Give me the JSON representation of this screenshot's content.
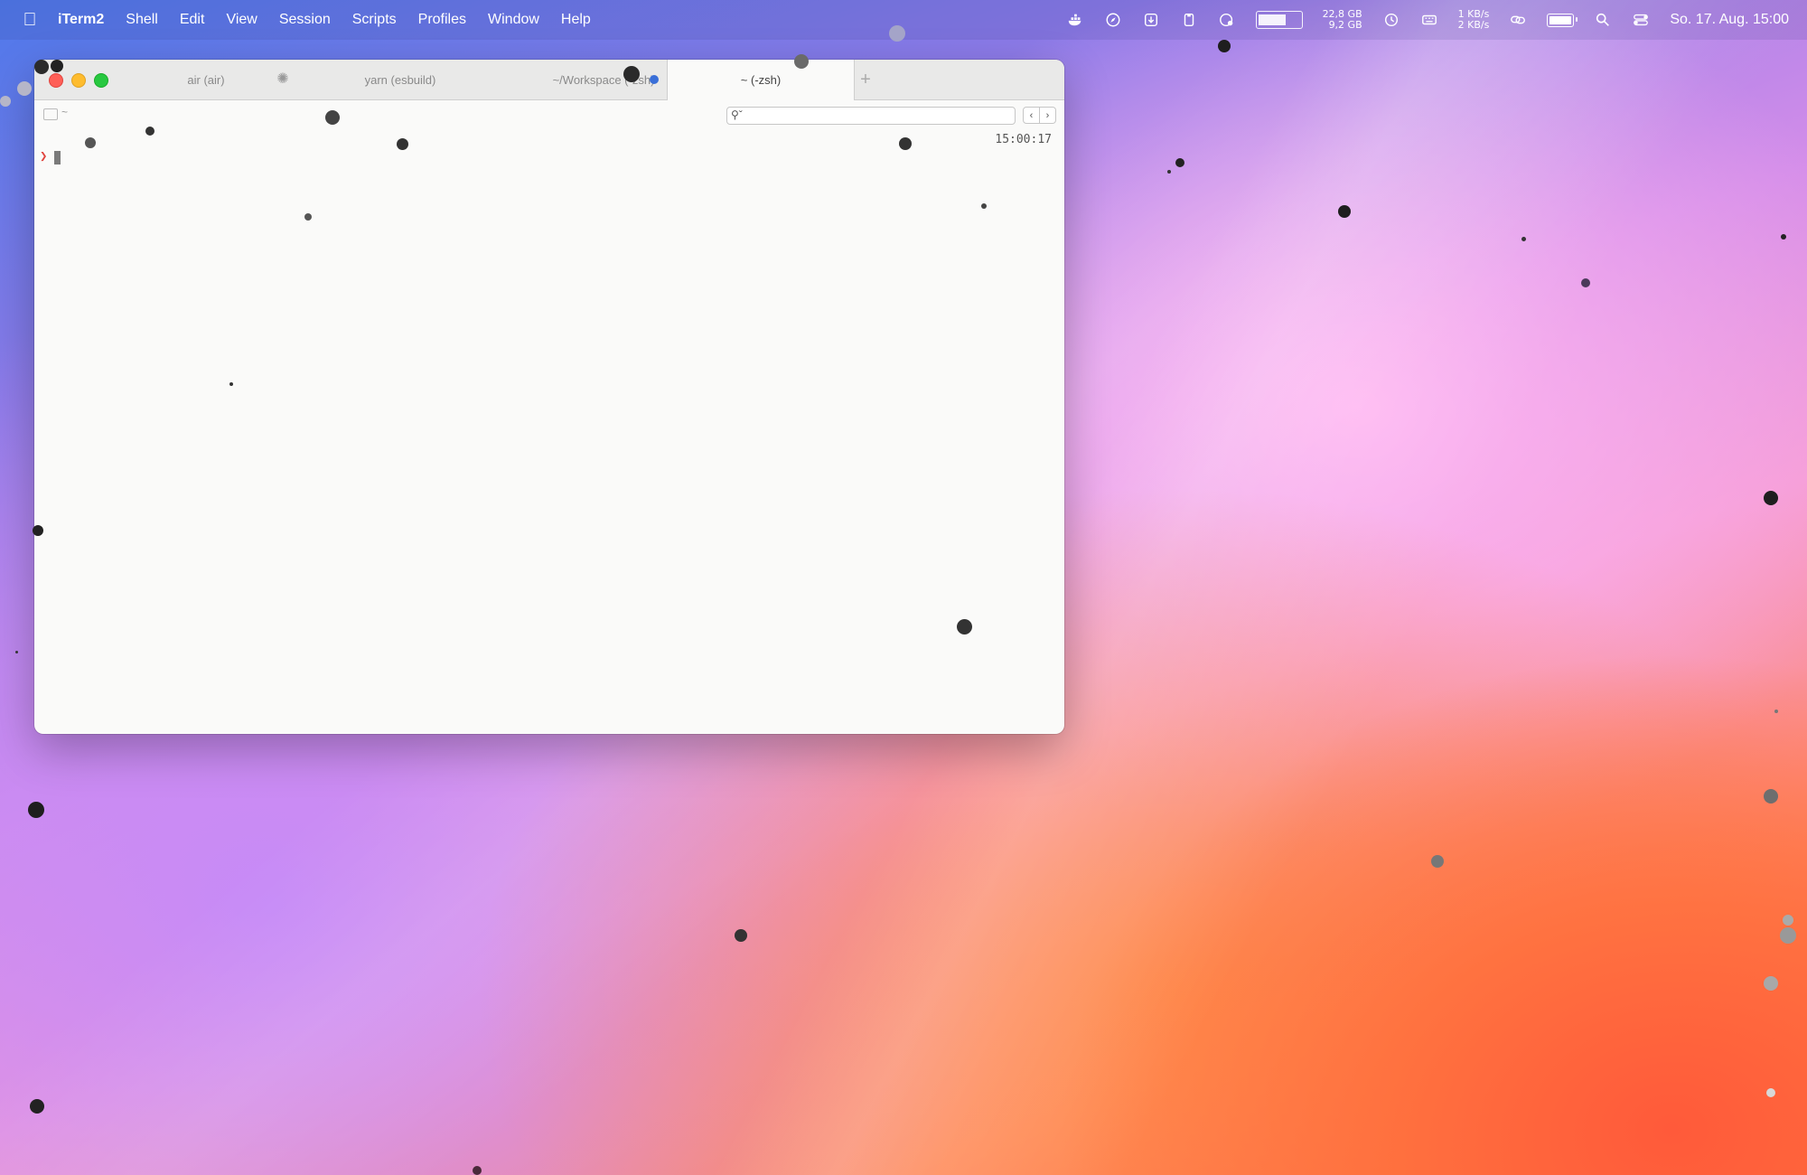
{
  "menubar": {
    "apple_icon": "apple-icon",
    "app_name": "iTerm2",
    "menus": [
      "Shell",
      "Edit",
      "View",
      "Session",
      "Scripts",
      "Profiles",
      "Window",
      "Help"
    ],
    "status": {
      "memory_used": "22,8 GB",
      "memory_free": "9,2 GB",
      "net_down": "1 KB/s",
      "net_up": "2 KB/s",
      "clock": "So. 17. Aug. 15:00"
    }
  },
  "window": {
    "tabs": [
      {
        "label": "air (air)"
      },
      {
        "label": "yarn (esbuild)"
      },
      {
        "label": "~/Workspace (-zsh)"
      },
      {
        "label": "~ (-zsh)"
      }
    ],
    "new_tab": "+",
    "path": "~",
    "search": {
      "placeholder": ""
    },
    "nav_prev": "‹",
    "nav_next": "›",
    "terminal": {
      "time": "15:00:17",
      "prompt": "❯"
    }
  },
  "colors": {
    "accent_blue": "#3a6fd8",
    "prompt_red": "#e0443e"
  }
}
